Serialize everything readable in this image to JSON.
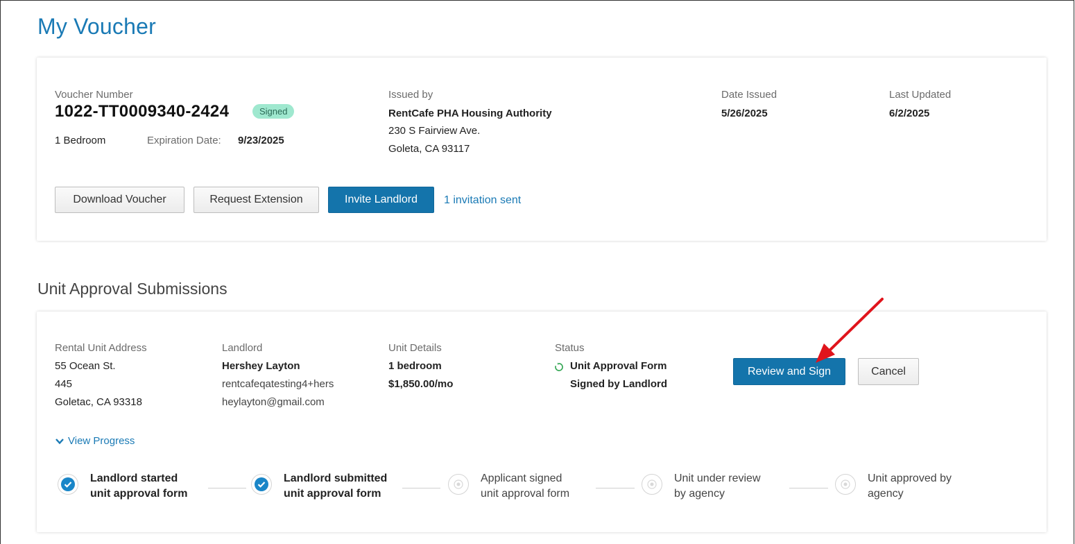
{
  "page": {
    "title": "My Voucher"
  },
  "voucher": {
    "number_label": "Voucher Number",
    "number": "1022-TT0009340-2424",
    "status_badge": "Signed",
    "bedrooms": "1 Bedroom",
    "expiration_label": "Expiration Date:",
    "expiration_date": "9/23/2025",
    "issued_by_label": "Issued by",
    "issuer_name": "RentCafe PHA Housing Authority",
    "issuer_address_line1": "230 S Fairview Ave.",
    "issuer_address_line2": "Goleta, CA 93117",
    "date_issued_label": "Date Issued",
    "date_issued": "5/26/2025",
    "last_updated_label": "Last Updated",
    "last_updated": "6/2/2025",
    "actions": {
      "download": "Download Voucher",
      "request_extension": "Request Extension",
      "invite_landlord": "Invite Landlord",
      "invitation_link": "1 invitation sent"
    },
    "badge_color": "#9fe8cf"
  },
  "unit_approval": {
    "section_title": "Unit Approval Submissions",
    "address_label": "Rental Unit Address",
    "address_line1": "55 Ocean St.",
    "address_line2": "445",
    "address_line3": "Goletac, CA 93318",
    "landlord_label": "Landlord",
    "landlord_name": "Hershey Layton",
    "landlord_email_line1": "rentcafeqatesting4+hers",
    "landlord_email_line2": "heylayton@gmail.com",
    "unit_details_label": "Unit Details",
    "unit_bedrooms": "1 bedroom",
    "unit_rent": "$1,850.00/mo",
    "status_label": "Status",
    "status_line1": "Unit Approval Form",
    "status_line2": "Signed by Landlord",
    "status_icon": "refresh-circle-icon",
    "review_button": "Review and Sign",
    "cancel_button": "Cancel",
    "view_progress": "View Progress",
    "steps": [
      {
        "line1": "Landlord started",
        "line2": "unit approval form",
        "done": true
      },
      {
        "line1": "Landlord submitted",
        "line2": "unit approval form",
        "done": true
      },
      {
        "line1": "Applicant signed",
        "line2": "unit approval form",
        "done": false
      },
      {
        "line1": "Unit under review",
        "line2": "by agency",
        "done": false
      },
      {
        "line1": "Unit approved by",
        "line2": "agency",
        "done": false
      }
    ]
  },
  "colors": {
    "primary": "#1474ab",
    "link": "#1a7ab5",
    "step_done": "#1a86c8",
    "annotation_arrow": "#e0141c"
  }
}
